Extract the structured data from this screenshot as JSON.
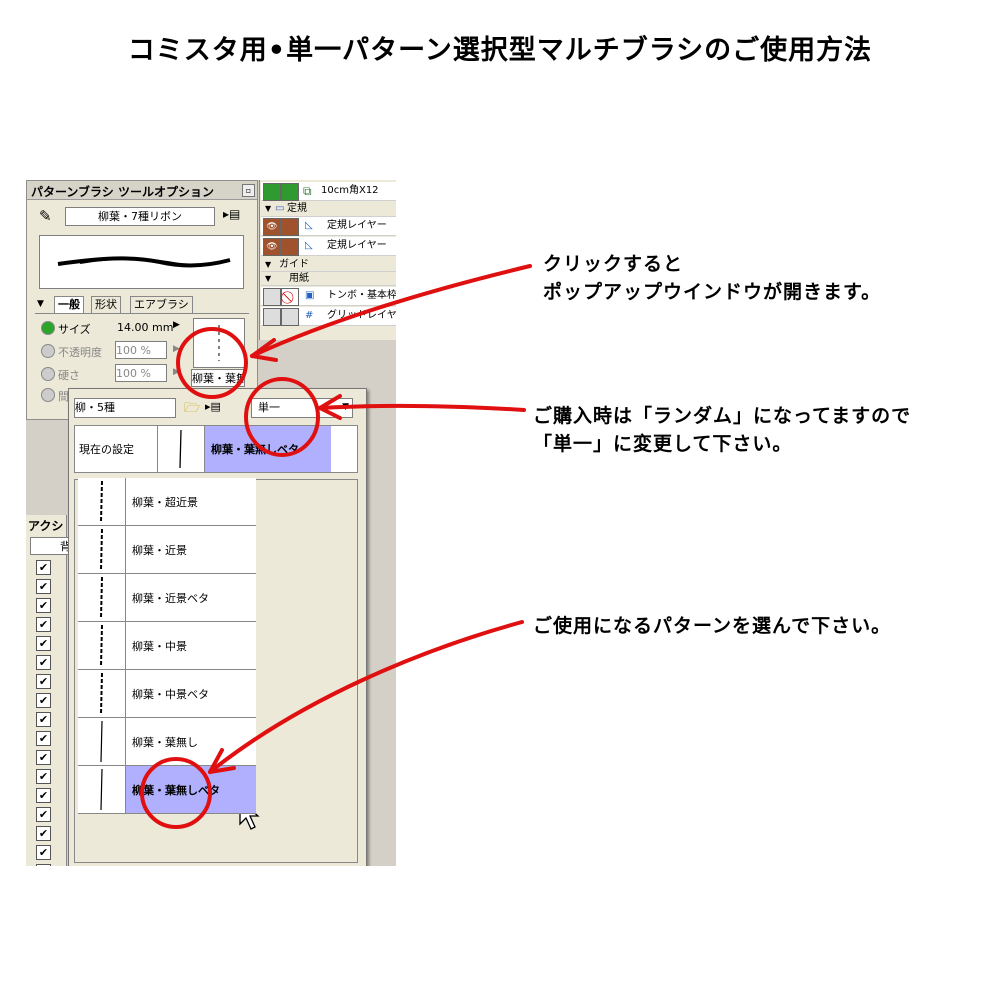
{
  "title": "コミスタ用•単一パターン選択型マルチブラシのご使用方法",
  "tool_options": {
    "header": "パターンブラシ ツールオプション",
    "brush_name": "柳葉・7種リボン",
    "tabs": [
      "一般",
      "形状",
      "エアブラシ"
    ],
    "size_label": "サイズ",
    "size_value": "14.00 mm",
    "opacity_label": "不透明度",
    "opacity_value": "100 %",
    "hardness_label": "硬さ",
    "hardness_value": "100 %",
    "partial_label": "間",
    "pattern_button_label": "柳葉・葉無"
  },
  "layers": {
    "top_item": "10cm角X12",
    "folder_ruler": "定規",
    "ruler_layer_1": "定規レイヤー",
    "ruler_layer_2": "定規レイヤー",
    "folder_guide": "ガイド",
    "folder_paper": "用紙",
    "tombo_layer": "トンボ・基本枠",
    "grid_layer": "グリッドレイヤー"
  },
  "actions": {
    "header": "アクシ",
    "sub": "背"
  },
  "popup": {
    "set_name": "柳・5種",
    "mode_value": "単一",
    "current_label": "現在の設定",
    "current_value": "柳葉・葉無しベタ",
    "patterns": [
      {
        "label": "柳葉・超近景"
      },
      {
        "label": "柳葉・近景"
      },
      {
        "label": "柳葉・近景ベタ"
      },
      {
        "label": "柳葉・中景"
      },
      {
        "label": "柳葉・中景ベタ"
      },
      {
        "label": "柳葉・葉無し"
      },
      {
        "label": "柳葉・葉無しベタ"
      }
    ],
    "selected_index": 6
  },
  "annotations": {
    "note1_line1": "クリックすると",
    "note1_line2": "ポップアップウインドウが開きます。",
    "note2_line1": "ご購入時は「ランダム」になってますので",
    "note2_line2": "「単一」に変更して下さい。",
    "note3": "ご使用になるパターンを選んで下さい。"
  },
  "colors": {
    "annotation_red": "#e01010",
    "selection_blue": "#b0b0ff",
    "green_radio": "#2aa52a"
  }
}
